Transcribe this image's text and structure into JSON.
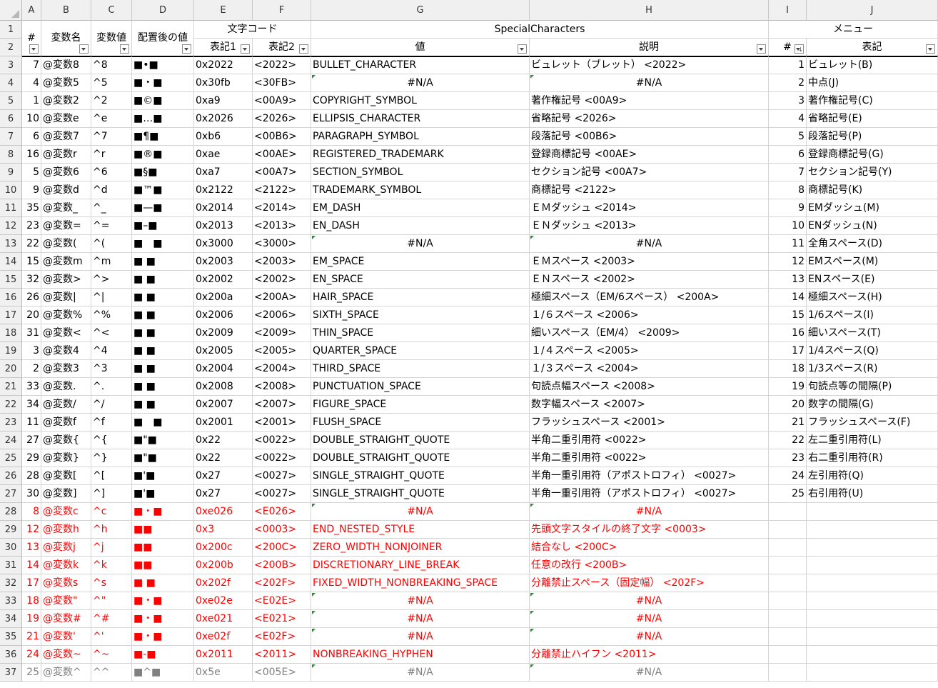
{
  "columns": [
    "A",
    "B",
    "C",
    "D",
    "E",
    "F",
    "G",
    "H",
    "I",
    "J"
  ],
  "header_row1": {
    "moji_code": "文字コード",
    "special_characters": "SpecialCharacters",
    "menu": "メニュー"
  },
  "header_row2": {
    "a": "#",
    "b": "変数名",
    "c": "変数値",
    "d": "配置後の値",
    "e": "表記1",
    "f": "表記2",
    "g": "値",
    "h": "説明",
    "i": "#",
    "j": "表記"
  },
  "rows": [
    {
      "row": 3,
      "a": "7",
      "b": "@変数8",
      "c": "^8",
      "d": "■•■",
      "e": "0x2022",
      "f": "<2022>",
      "g": "BULLET_CHARACTER",
      "h": "ビュレット（ブレット） <2022>",
      "i": "1",
      "j": "ビュレット(B)",
      "style": ""
    },
    {
      "row": 4,
      "a": "4",
      "b": "@変数5",
      "c": "^5",
      "d": "■・■",
      "e": "0x30fb",
      "f": "<30FB>",
      "g": "#N/A",
      "h": "#N/A",
      "i": "2",
      "j": "中点(J)",
      "style": "",
      "gna": true,
      "hna": true
    },
    {
      "row": 5,
      "a": "1",
      "b": "@変数2",
      "c": "^2",
      "d": "■©■",
      "e": "0xa9",
      "f": "<00A9>",
      "g": "COPYRIGHT_SYMBOL",
      "h": "著作権記号 <00A9>",
      "i": "3",
      "j": "著作権記号(C)",
      "style": ""
    },
    {
      "row": 6,
      "a": "10",
      "b": "@変数e",
      "c": "^e",
      "d": "■…■",
      "e": "0x2026",
      "f": "<2026>",
      "g": "ELLIPSIS_CHARACTER",
      "h": "省略記号 <2026>",
      "i": "4",
      "j": "省略記号(E)",
      "style": ""
    },
    {
      "row": 7,
      "a": "6",
      "b": "@変数7",
      "c": "^7",
      "d": "■¶■",
      "e": "0xb6",
      "f": "<00B6>",
      "g": "PARAGRAPH_SYMBOL",
      "h": "段落記号 <00B6>",
      "i": "5",
      "j": "段落記号(P)",
      "style": ""
    },
    {
      "row": 8,
      "a": "16",
      "b": "@変数r",
      "c": "^r",
      "d": "■®■",
      "e": "0xae",
      "f": "<00AE>",
      "g": "REGISTERED_TRADEMARK",
      "h": "登録商標記号 <00AE>",
      "i": "6",
      "j": "登録商標記号(G)",
      "style": ""
    },
    {
      "row": 9,
      "a": "5",
      "b": "@変数6",
      "c": "^6",
      "d": "■§■",
      "e": "0xa7",
      "f": "<00A7>",
      "g": "SECTION_SYMBOL",
      "h": "セクション記号 <00A7>",
      "i": "7",
      "j": "セクション記号(Y)",
      "style": ""
    },
    {
      "row": 10,
      "a": "9",
      "b": "@変数d",
      "c": "^d",
      "d": "■™■",
      "e": "0x2122",
      "f": "<2122>",
      "g": "TRADEMARK_SYMBOL",
      "h": "商標記号 <2122>",
      "i": "8",
      "j": "商標記号(K)",
      "style": ""
    },
    {
      "row": 11,
      "a": "35",
      "b": "@変数_",
      "c": "^_",
      "d": "■—■",
      "e": "0x2014",
      "f": "<2014>",
      "g": "EM_DASH",
      "h": "ＥＭダッシュ <2014>",
      "i": "9",
      "j": "EMダッシュ(M)",
      "style": ""
    },
    {
      "row": 12,
      "a": "23",
      "b": "@変数=",
      "c": "^=",
      "d": "■–■",
      "e": "0x2013",
      "f": "<2013>",
      "g": "EN_DASH",
      "h": "ＥＮダッシュ <2013>",
      "i": "10",
      "j": "ENダッシュ(N)",
      "style": ""
    },
    {
      "row": 13,
      "a": "22",
      "b": "@変数(",
      "c": "^(",
      "d": "■　■",
      "e": "0x3000",
      "f": "<3000>",
      "g": "#N/A",
      "h": "#N/A",
      "i": "11",
      "j": "全角スペース(D)",
      "style": "",
      "gna": true,
      "hna": true
    },
    {
      "row": 14,
      "a": "15",
      "b": "@変数m",
      "c": "^m",
      "d": "■ ■",
      "e": "0x2003",
      "f": "<2003>",
      "g": "EM_SPACE",
      "h": "ＥＭスペース <2003>",
      "i": "12",
      "j": "EMスペース(M)",
      "style": ""
    },
    {
      "row": 15,
      "a": "32",
      "b": "@変数>",
      "c": "^>",
      "d": "■ ■",
      "e": "0x2002",
      "f": "<2002>",
      "g": "EN_SPACE",
      "h": "ＥＮスペース <2002>",
      "i": "13",
      "j": "ENスペース(E)",
      "style": ""
    },
    {
      "row": 16,
      "a": "26",
      "b": "@変数|",
      "c": "^|",
      "d": "■ ■",
      "e": "0x200a",
      "f": "<200A>",
      "g": "HAIR_SPACE",
      "h": "極細スペース（EM/6スペース） <200A>",
      "i": "14",
      "j": "極細スペース(H)",
      "style": ""
    },
    {
      "row": 17,
      "a": "20",
      "b": "@変数%",
      "c": "^%",
      "d": "■ ■",
      "e": "0x2006",
      "f": "<2006>",
      "g": "SIXTH_SPACE",
      "h": "１/６スペース <2006>",
      "i": "15",
      "j": "1/6スペース(I)",
      "style": ""
    },
    {
      "row": 18,
      "a": "31",
      "b": "@変数<",
      "c": "^<",
      "d": "■ ■",
      "e": "0x2009",
      "f": "<2009>",
      "g": "THIN_SPACE",
      "h": "細いスペース（EM/4） <2009>",
      "i": "16",
      "j": "細いスペース(T)",
      "style": ""
    },
    {
      "row": 19,
      "a": "3",
      "b": "@変数4",
      "c": "^4",
      "d": "■ ■",
      "e": "0x2005",
      "f": "<2005>",
      "g": "QUARTER_SPACE",
      "h": "１/４スペース <2005>",
      "i": "17",
      "j": "1/4スペース(Q)",
      "style": ""
    },
    {
      "row": 20,
      "a": "2",
      "b": "@変数3",
      "c": "^3",
      "d": "■ ■",
      "e": "0x2004",
      "f": "<2004>",
      "g": "THIRD_SPACE",
      "h": "１/３スペース <2004>",
      "i": "18",
      "j": "1/3スペース(R)",
      "style": ""
    },
    {
      "row": 21,
      "a": "33",
      "b": "@変数.",
      "c": "^.",
      "d": "■ ■",
      "e": "0x2008",
      "f": "<2008>",
      "g": "PUNCTUATION_SPACE",
      "h": "句読点幅スペース <2008>",
      "i": "19",
      "j": "句読点等の間隔(P)",
      "style": ""
    },
    {
      "row": 22,
      "a": "34",
      "b": "@変数/",
      "c": "^/",
      "d": "■ ■",
      "e": "0x2007",
      "f": "<2007>",
      "g": "FIGURE_SPACE",
      "h": "数字幅スペース <2007>",
      "i": "20",
      "j": "数字の間隔(G)",
      "style": ""
    },
    {
      "row": 23,
      "a": "11",
      "b": "@変数f",
      "c": "^f",
      "d": "■　■",
      "e": "0x2001",
      "f": "<2001>",
      "g": "FLUSH_SPACE",
      "h": "フラッシュスペース <2001>",
      "i": "21",
      "j": "フラッシュスペース(F)",
      "style": ""
    },
    {
      "row": 24,
      "a": "27",
      "b": "@変数{",
      "c": "^{",
      "d": "■\"■",
      "e": "0x22",
      "f": "<0022>",
      "g": "DOUBLE_STRAIGHT_QUOTE",
      "h": "半角二重引用符 <0022>",
      "i": "22",
      "j": "左二重引用符(L)",
      "style": ""
    },
    {
      "row": 25,
      "a": "29",
      "b": "@変数}",
      "c": "^}",
      "d": "■\"■",
      "e": "0x22",
      "f": "<0022>",
      "g": "DOUBLE_STRAIGHT_QUOTE",
      "h": "半角二重引用符 <0022>",
      "i": "23",
      "j": "右二重引用符(R)",
      "style": ""
    },
    {
      "row": 26,
      "a": "28",
      "b": "@変数[",
      "c": "^[",
      "d": "■'■",
      "e": "0x27",
      "f": "<0027>",
      "g": "SINGLE_STRAIGHT_QUOTE",
      "h": "半角一重引用符（アポストロフィ） <0027>",
      "i": "24",
      "j": "左引用符(Q)",
      "style": ""
    },
    {
      "row": 27,
      "a": "30",
      "b": "@変数]",
      "c": "^]",
      "d": "■'■",
      "e": "0x27",
      "f": "<0027>",
      "g": "SINGLE_STRAIGHT_QUOTE",
      "h": "半角一重引用符（アポストロフィ） <0027>",
      "i": "25",
      "j": "右引用符(U)",
      "style": ""
    },
    {
      "row": 28,
      "a": "8",
      "b": "@変数c",
      "c": "^c",
      "d": "■・■",
      "e": "0xe026",
      "f": "<E026>",
      "g": "#N/A",
      "h": "#N/A",
      "i": "",
      "j": "",
      "style": "red",
      "gna": true,
      "hna": true
    },
    {
      "row": 29,
      "a": "12",
      "b": "@変数h",
      "c": "^h",
      "d": "■■",
      "e": "0x3",
      "f": "<0003>",
      "g": "END_NESTED_STYLE",
      "h": "先頭文字スタイルの終了文字 <0003>",
      "i": "",
      "j": "",
      "style": "red"
    },
    {
      "row": 30,
      "a": "13",
      "b": "@変数j",
      "c": "^j",
      "d": "■■",
      "e": "0x200c",
      "f": "<200C>",
      "g": "ZERO_WIDTH_NONJOINER",
      "h": "結合なし <200C>",
      "i": "",
      "j": "",
      "style": "red"
    },
    {
      "row": 31,
      "a": "14",
      "b": "@変数k",
      "c": "^k",
      "d": "■■",
      "e": "0x200b",
      "f": "<200B>",
      "g": "DISCRETIONARY_LINE_BREAK",
      "h": "任意の改行 <200B>",
      "i": "",
      "j": "",
      "style": "red"
    },
    {
      "row": 32,
      "a": "17",
      "b": "@変数s",
      "c": "^s",
      "d": "■ ■",
      "e": "0x202f",
      "f": "<202F>",
      "g": "FIXED_WIDTH_NONBREAKING_SPACE",
      "h": "分離禁止スペース（固定幅） <202F>",
      "i": "",
      "j": "",
      "style": "red"
    },
    {
      "row": 33,
      "a": "18",
      "b": "@変数\"",
      "c": "^\"",
      "d": "■・■",
      "e": "0xe02e",
      "f": "<E02E>",
      "g": "#N/A",
      "h": "#N/A",
      "i": "",
      "j": "",
      "style": "red",
      "gna": true,
      "hna": true
    },
    {
      "row": 34,
      "a": "19",
      "b": "@変数#",
      "c": "^#",
      "d": "■・■",
      "e": "0xe021",
      "f": "<E021>",
      "g": "#N/A",
      "h": "#N/A",
      "i": "",
      "j": "",
      "style": "red",
      "gna": true,
      "hna": true
    },
    {
      "row": 35,
      "a": "21",
      "b": "@変数'",
      "c": "^'",
      "d": "■・■",
      "e": "0xe02f",
      "f": "<E02F>",
      "g": "#N/A",
      "h": "#N/A",
      "i": "",
      "j": "",
      "style": "red",
      "gna": true,
      "hna": true
    },
    {
      "row": 36,
      "a": "24",
      "b": "@変数~",
      "c": "^~",
      "d": "■-■",
      "e": "0x2011",
      "f": "<2011>",
      "g": "NONBREAKING_HYPHEN",
      "h": "分離禁止ハイフン <2011>",
      "i": "",
      "j": "",
      "style": "red"
    },
    {
      "row": 37,
      "a": "25",
      "b": "@変数^",
      "c": "^^",
      "d": "■^■",
      "e": "0x5e",
      "f": "<005E>",
      "g": "#N/A",
      "h": "#N/A",
      "i": "",
      "j": "",
      "style": "grey",
      "gna": true,
      "hna": true
    }
  ]
}
